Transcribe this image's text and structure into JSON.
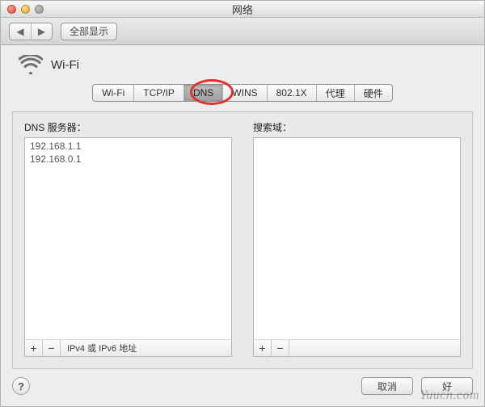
{
  "window": {
    "title": "网络"
  },
  "toolbar": {
    "back_icon": "◀",
    "forward_icon": "▶",
    "show_all_label": "全部显示"
  },
  "interface": {
    "name": "Wi-Fi"
  },
  "tabs": {
    "items": [
      "Wi-Fi",
      "TCP/IP",
      "DNS",
      "WINS",
      "802.1X",
      "代理",
      "硬件"
    ],
    "selected_index": 2
  },
  "dns_panel": {
    "servers_label": "DNS 服务器：",
    "servers": [
      "192.168.1.1",
      "192.168.0.1"
    ],
    "search_label": "搜索域：",
    "search_domains": [],
    "footnote": "IPv4 或 IPv6 地址"
  },
  "buttons": {
    "add": "+",
    "remove": "−",
    "help": "?",
    "cancel": "取消",
    "ok": "好"
  },
  "watermark": "Yuucn.com"
}
